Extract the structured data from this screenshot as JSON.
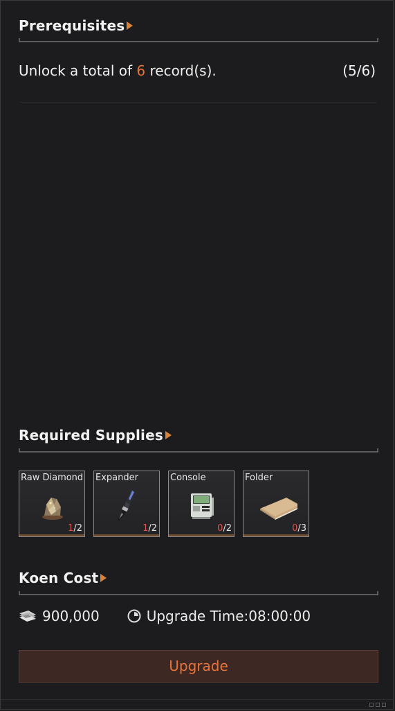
{
  "prerequisites": {
    "title": "Prerequisites",
    "text_before": "Unlock a total of ",
    "count": "6",
    "text_after": " record(s).",
    "progress": "(5/6)"
  },
  "supplies": {
    "title": "Required Supplies",
    "items": [
      {
        "name": "Raw Diamond",
        "have": "1",
        "need": "/2",
        "icon": "raw-diamond-icon"
      },
      {
        "name": "Expander",
        "have": "1",
        "need": "/2",
        "icon": "expander-icon"
      },
      {
        "name": "Console",
        "have": "0",
        "need": "/2",
        "icon": "console-icon"
      },
      {
        "name": "Folder",
        "have": "0",
        "need": "/3",
        "icon": "folder-icon"
      }
    ]
  },
  "cost": {
    "title": "Koen Cost",
    "amount": "900,000",
    "time": "Upgrade Time:08:00:00"
  },
  "actions": {
    "upgrade_label": "Upgrade"
  },
  "colors": {
    "accent": "#e8733a",
    "shortage": "#e0554f",
    "button_bg": "#3d2823"
  }
}
